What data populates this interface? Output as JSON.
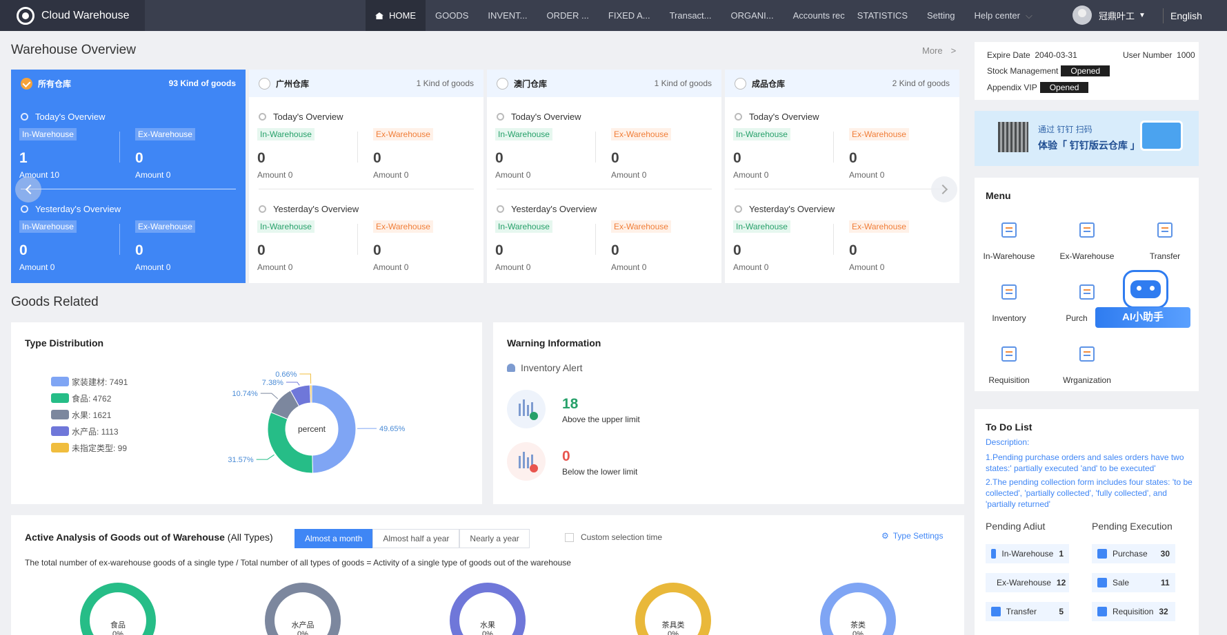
{
  "app": {
    "title": "Cloud Warehouse"
  },
  "nav": {
    "items": [
      "HOME",
      "GOODS",
      "INVENT...",
      "ORDER ...",
      "FIXED A...",
      "Transact...",
      "ORGANI...",
      "Accounts rec",
      "STATISTICS",
      "Setting",
      "Help center"
    ],
    "user": "冠鼎叶工",
    "language": "English"
  },
  "overview": {
    "title": "Warehouse Overview",
    "more": "More",
    "today": "Today's Overview",
    "yesterday": "Yesterday's Overview",
    "in_label": "In-Warehouse",
    "ex_label": "Ex-Warehouse",
    "warehouses": [
      {
        "name": "所有仓库",
        "kinds": "93 Kind of goods",
        "today_in": "1",
        "today_in_amt": "Amount 10",
        "today_ex": "0",
        "today_ex_amt": "Amount 0",
        "yest_in": "0",
        "yest_in_amt": "Amount 0",
        "yest_ex": "0",
        "yest_ex_amt": "Amount 0"
      },
      {
        "name": "广州仓库",
        "kinds": "1 Kind of goods",
        "today_in": "0",
        "today_in_amt": "Amount 0",
        "today_ex": "0",
        "today_ex_amt": "Amount 0",
        "yest_in": "0",
        "yest_in_amt": "Amount 0",
        "yest_ex": "0",
        "yest_ex_amt": "Amount 0"
      },
      {
        "name": "澳门仓库",
        "kinds": "1 Kind of goods",
        "today_in": "0",
        "today_in_amt": "Amount 0",
        "today_ex": "0",
        "today_ex_amt": "Amount 0",
        "yest_in": "0",
        "yest_in_amt": "Amount 0",
        "yest_ex": "0",
        "yest_ex_amt": "Amount 0"
      },
      {
        "name": "成品仓库",
        "kinds": "2 Kind of goods",
        "today_in": "0",
        "today_in_amt": "Amount 0",
        "today_ex": "0",
        "today_ex_amt": "Amount 0",
        "yest_in": "0",
        "yest_in_amt": "Amount 0",
        "yest_ex": "0",
        "yest_ex_amt": "Amount 0"
      }
    ]
  },
  "goods": {
    "title": "Goods Related"
  },
  "type_dist": {
    "title": "Type Distribution",
    "center": "percent"
  },
  "chart_data": {
    "type": "pie",
    "categories": [
      "家装建材",
      "食品",
      "水果",
      "水产品",
      "未指定类型"
    ],
    "counts": [
      "家装建材: 7491",
      "食品: 4762",
      "水果: 1621",
      "水产品: 1113",
      "未指定类型: 99"
    ],
    "values": [
      7491,
      4762,
      1621,
      1113,
      99
    ],
    "percent_labels": [
      "49.65%",
      "31.57%",
      "10.74%",
      "7.38%",
      "0.66%"
    ],
    "colors": [
      "#7fa5f4",
      "#26bd87",
      "#7c879e",
      "#6f77d9",
      "#f0bd3e"
    ],
    "donut": true
  },
  "warning": {
    "title": "Warning Information",
    "subtitle": "Inventory Alert",
    "upper": "18",
    "upper_label": "Above the upper limit",
    "lower": "0",
    "lower_label": "Below the lower limit"
  },
  "activity": {
    "title": "Active Analysis of Goods out of Warehouse",
    "subtitle": "(All Types)",
    "ranges": [
      "Almost a month",
      "Almost half a year",
      "Nearly a year"
    ],
    "custom": "Custom selection time",
    "settings": "Type Settings",
    "formula": "The total number of ex-warehouse goods of a single type / Total number of all types of goods = Activity of a single type of goods out of the warehouse",
    "rings": [
      {
        "name": "食品",
        "pct": "0%",
        "color": "#26bd87"
      },
      {
        "name": "水产品",
        "pct": "0%",
        "color": "#7c879e"
      },
      {
        "name": "水果",
        "pct": "0%",
        "color": "#6f77d9"
      },
      {
        "name": "茶具类",
        "pct": "0%",
        "color": "#e9b83a"
      },
      {
        "name": "茶类",
        "pct": "0%",
        "color": "#7fa5f4"
      }
    ]
  },
  "account": {
    "expire_label": "Expire Date",
    "expire": "2040-03-31",
    "user_label": "User Number",
    "user_number": "1000",
    "stock_label": "Stock Management",
    "stock_status": "Opened",
    "vip_label": "Appendix VIP",
    "vip_status": "Opened"
  },
  "banner": {
    "line1": "通过 钉钉 扫码",
    "line2": "体验「 钉钉版云仓库 」"
  },
  "menu": {
    "title": "Menu",
    "items": [
      "In-Warehouse",
      "Ex-Warehouse",
      "Transfer",
      "Inventory",
      "Purch",
      "Requisition",
      "Wrganization"
    ],
    "assistant": "AI小助手"
  },
  "todo": {
    "title": "To Do List",
    "desc_label": "Description:",
    "desc1": "1.Pending purchase orders and sales orders have two states:' partially executed 'and' to be executed'",
    "desc2": "2.The pending collection form includes four states: 'to be collected', 'partially collected', 'fully collected', and 'partially returned'",
    "pending_audit": "Pending Adiut",
    "pending_exec": "Pending Execution",
    "audit": [
      {
        "label": "In-Warehouse",
        "n": "1"
      },
      {
        "label": "Ex-Warehouse",
        "n": "12"
      },
      {
        "label": "Transfer",
        "n": "5"
      }
    ],
    "exec": [
      {
        "label": "Purchase",
        "n": "30"
      },
      {
        "label": "Sale",
        "n": "11"
      },
      {
        "label": "Requisition",
        "n": "32"
      }
    ]
  }
}
